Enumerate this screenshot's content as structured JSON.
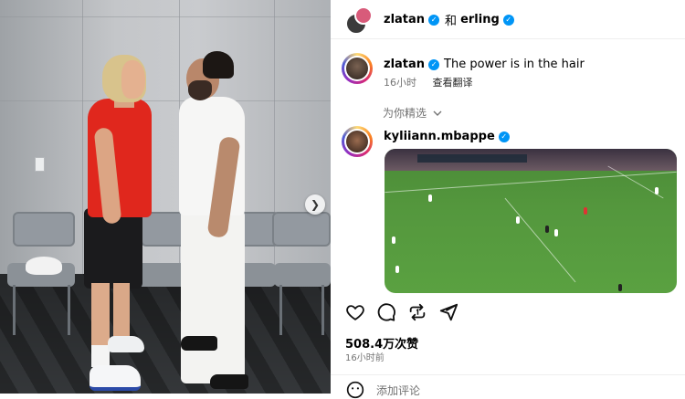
{
  "post": {
    "author": "zlatan",
    "and_label": "和",
    "coauthor": "erling"
  },
  "caption": {
    "username": "zlatan",
    "text": "The power is in the hair",
    "time_ago": "16小时",
    "translate_label": "查看翻译"
  },
  "suggested_label": "为你精选",
  "comment": {
    "username": "kyliiann.mbappe"
  },
  "likes_text": "508.4万次赞",
  "timestamp": "16小时前",
  "add_comment_placeholder": "添加评论",
  "icons": {
    "like": "heart-icon",
    "comment": "comment-icon",
    "repost": "repost-icon",
    "share": "share-icon",
    "next": "chevron-right-icon",
    "suggested": "chevron-down-icon",
    "verified": "verified-badge-icon",
    "emoji": "emoji-icon"
  },
  "colors": {
    "verified": "#0095f6",
    "shirt_red": "#e0271d",
    "muted_text": "#737373"
  }
}
